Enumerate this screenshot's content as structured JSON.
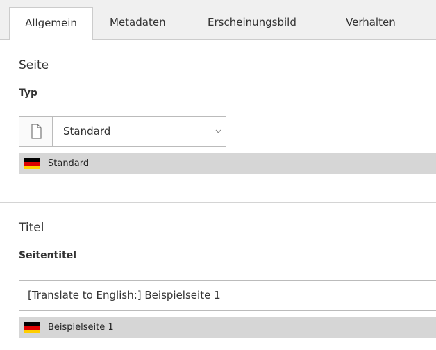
{
  "tabs": [
    {
      "label": "Allgemein",
      "active": true
    },
    {
      "label": "Metadaten",
      "active": false
    },
    {
      "label": "Erscheinungsbild",
      "active": false
    },
    {
      "label": "Verhalten",
      "active": false
    }
  ],
  "sections": {
    "page": {
      "title": "Seite",
      "type_label": "Typ",
      "type_select": {
        "value": "Standard",
        "icon": "page-icon"
      },
      "default_language_value": {
        "flag": "de-flag",
        "text": "Standard"
      }
    },
    "title": {
      "title": "Titel",
      "page_title_label": "Seitentitel",
      "page_title_input": {
        "value": "[Translate to English:] Beispielseite 1"
      },
      "default_language_value": {
        "flag": "de-flag",
        "text": "Beispielseite 1"
      }
    }
  },
  "colors": {
    "flag_black": "#000000",
    "flag_red": "#dd0000",
    "flag_gold": "#ffce00",
    "tabbar_bg": "#f0f0f0",
    "lang_row_bg": "#d6d6d6"
  }
}
